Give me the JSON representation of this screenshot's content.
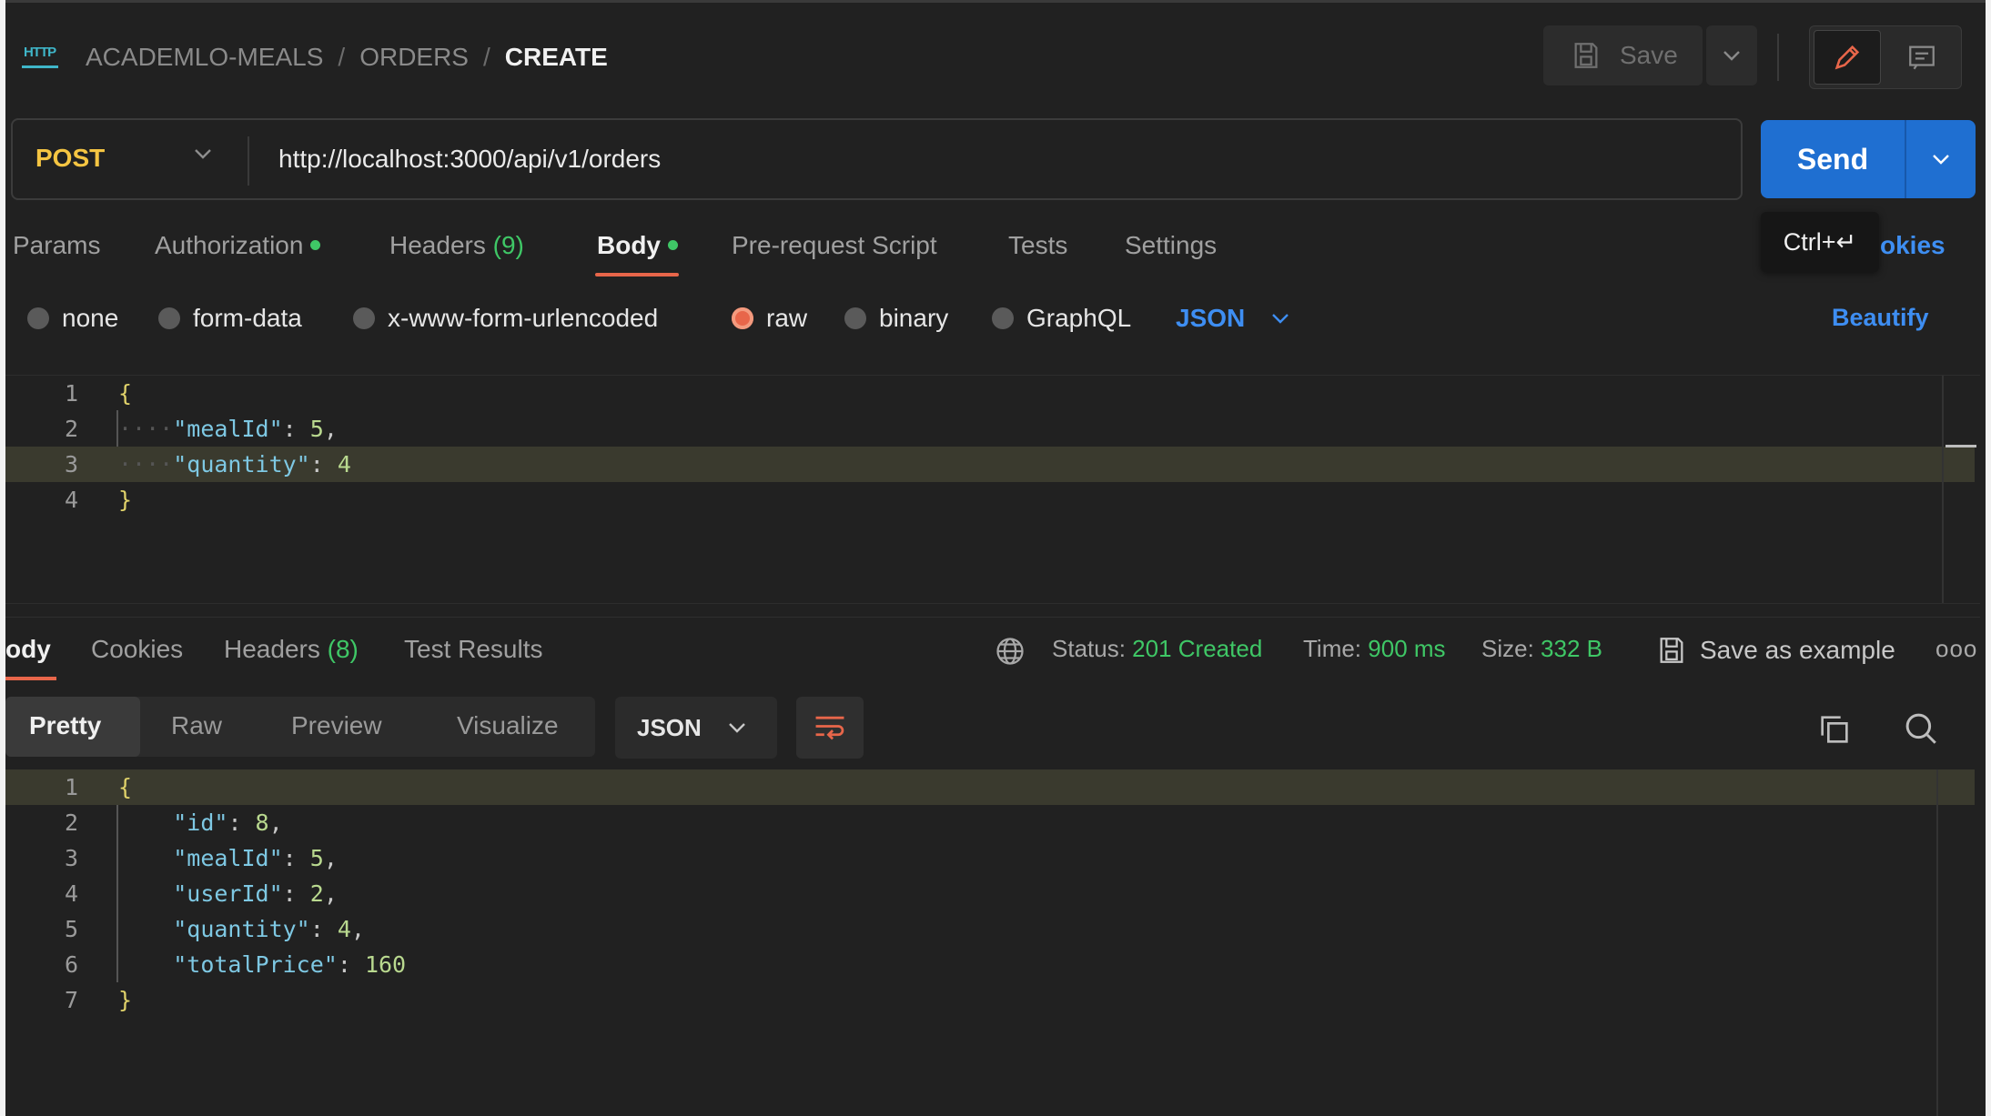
{
  "breadcrumb": {
    "items": [
      "ACADEMLO-MEALS",
      "ORDERS"
    ],
    "separator": "/",
    "current": "CREATE"
  },
  "header": {
    "save_label": "Save",
    "http_icon_text": "HTTP"
  },
  "request": {
    "method": "POST",
    "url": "http://localhost:3000/api/v1/orders",
    "send_label": "Send",
    "tooltip": "Ctrl+↵",
    "cookies_link": "okies",
    "tabs": [
      {
        "label": "Params"
      },
      {
        "label": "Authorization"
      },
      {
        "label": "Headers",
        "count": "(9)"
      },
      {
        "label": "Body"
      },
      {
        "label": "Pre-request Script"
      },
      {
        "label": "Tests"
      },
      {
        "label": "Settings"
      }
    ],
    "body_types": [
      "none",
      "form-data",
      "x-www-form-urlencoded",
      "raw",
      "binary",
      "GraphQL"
    ],
    "selected_body_type": "raw",
    "raw_format": "JSON",
    "beautify_label": "Beautify",
    "code_lines": [
      {
        "n": "1",
        "text": "{"
      },
      {
        "n": "2",
        "key": "\"mealId\"",
        "sep": ": ",
        "value": "5",
        "trail": ","
      },
      {
        "n": "3",
        "key": "\"quantity\"",
        "sep": ": ",
        "value": "4",
        "trail": ""
      },
      {
        "n": "4",
        "text": "}"
      }
    ]
  },
  "response": {
    "tabs": [
      "ody",
      "Cookies",
      "Headers",
      "Test Results"
    ],
    "headers_count": "(8)",
    "status_label": "Status:",
    "status_value": "201 Created",
    "time_label": "Time:",
    "time_value": "900 ms",
    "size_label": "Size:",
    "size_value": "332 B",
    "save_example_label": "Save as example",
    "more_label": "ooo",
    "view_tabs": [
      "Pretty",
      "Raw",
      "Preview",
      "Visualize"
    ],
    "format": "JSON",
    "code_lines": [
      {
        "n": "1",
        "text": "{"
      },
      {
        "n": "2",
        "key": "\"id\"",
        "sep": ": ",
        "value": "8",
        "trail": ","
      },
      {
        "n": "3",
        "key": "\"mealId\"",
        "sep": ": ",
        "value": "5",
        "trail": ","
      },
      {
        "n": "4",
        "key": "\"userId\"",
        "sep": ": ",
        "value": "2",
        "trail": ","
      },
      {
        "n": "5",
        "key": "\"quantity\"",
        "sep": ": ",
        "value": "4",
        "trail": ","
      },
      {
        "n": "6",
        "key": "\"totalPrice\"",
        "sep": ": ",
        "value": "160",
        "trail": ""
      },
      {
        "n": "7",
        "text": "}"
      }
    ]
  },
  "colors": {
    "accent": "#1f6fd1",
    "ok": "#3fc766",
    "method": "#f5c542",
    "active_tab": "#e8664a",
    "link": "#3e8ef2"
  }
}
